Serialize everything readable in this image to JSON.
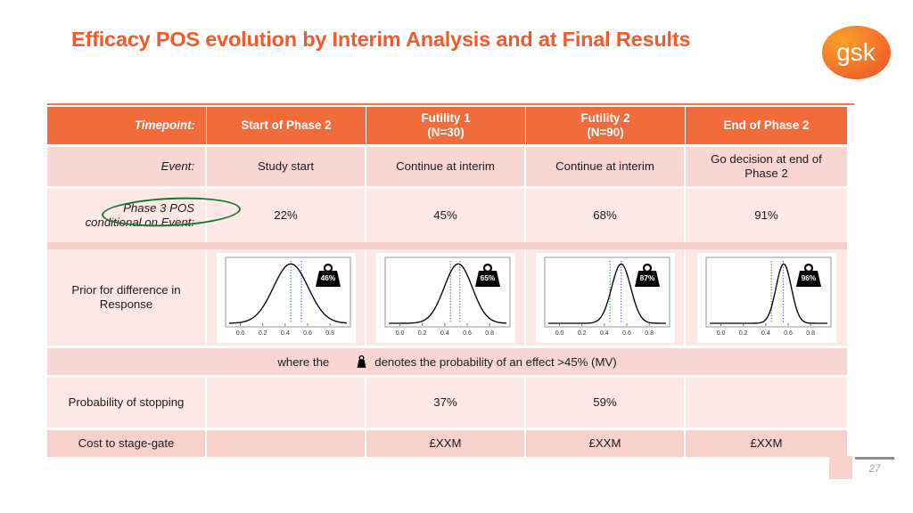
{
  "slide": {
    "title": "Efficacy POS evolution by Interim Analysis and at Final Results",
    "logo_text": "gsk",
    "page_number": "27",
    "accent_orange": "#F15A2B",
    "header_orange": "#F26B3A",
    "row_pink_dark": "#F9D6D1",
    "row_pink_light": "#FCE8E5",
    "annotation_green": "#11792E"
  },
  "table": {
    "header": {
      "label": "Timepoint:",
      "columns": [
        "Start of Phase 2",
        "Futility 1\n(N=30)",
        "Futility 2\n(N=90)",
        "End of Phase 2"
      ],
      "col1_line1": "Start of Phase 2",
      "col1_line2": "",
      "col2_line1": "Futility 1",
      "col2_line2": "(N=30)",
      "col3_line1": "Futility 2",
      "col3_line2": "(N=90)",
      "col4_line1": "End of Phase 2",
      "col4_line2": ""
    },
    "rows": [
      {
        "id": "event",
        "label": "Event:",
        "values": [
          "Study start",
          "Continue at interim",
          "Continue at interim",
          "Go decision at end of Phase 2"
        ],
        "v0": "Study start",
        "v1": "Continue at interim",
        "v2": "Continue at interim",
        "v3_line1": "Go decision at end of",
        "v3_line2": "Phase 2"
      },
      {
        "id": "phase3-pos",
        "label_line1": "Phase 3 POS",
        "label_line2": "conditional on Event:",
        "values": [
          "22%",
          "45%",
          "68%",
          "91%"
        ],
        "v0": "22%",
        "v1": "45%",
        "v2": "68%",
        "v3": "91%"
      },
      {
        "id": "prior-difference",
        "label_line1": "Prior for difference in",
        "label_line2": "Response"
      },
      {
        "id": "probability-of-stopping",
        "label": "Probability of stopping",
        "values": [
          "",
          "37%",
          "59%",
          ""
        ],
        "v0": "",
        "v1": "37%",
        "v2": "59%",
        "v3": ""
      },
      {
        "id": "cost-to-stage-gate",
        "label": "Cost to stage-gate",
        "values": [
          "",
          "£XXM",
          "£XXM",
          "£XXM"
        ],
        "v0": "",
        "v1": "£XXM",
        "v2": "£XXM",
        "v3": "£XXM"
      }
    ],
    "note": {
      "prefix": "where the",
      "suffix": "denotes the probability of an effect >45% (MV)",
      "icon": "weight-icon"
    }
  },
  "chart_data": [
    {
      "type": "line",
      "id": "prior-start-of-phase-2",
      "title": "",
      "xlabel": "",
      "ylabel": "",
      "xlim": [
        -0.1,
        0.95
      ],
      "ylim": [
        0,
        1.05
      ],
      "ticks": [
        "0.0",
        "0.2",
        "0.4",
        "0.6",
        "0.8"
      ],
      "tick_values": [
        0.0,
        0.2,
        0.4,
        0.6,
        0.8
      ],
      "grid": false,
      "curve": {
        "mean": 0.45,
        "sd": 0.155,
        "peak": 1.0
      },
      "vlines": [
        {
          "x": 0.45,
          "color": "#2E7D32",
          "style": "dotted",
          "name": "mean"
        },
        {
          "x": 0.545,
          "color": "#4C4CC8",
          "style": "dotted",
          "name": "threshold"
        }
      ],
      "badge": "46%",
      "badge_icon": "weight-icon"
    },
    {
      "type": "line",
      "id": "prior-futility-1",
      "title": "",
      "xlabel": "",
      "ylabel": "",
      "xlim": [
        -0.1,
        0.95
      ],
      "ylim": [
        0,
        1.05
      ],
      "ticks": [
        "0.0",
        "0.2",
        "0.4",
        "0.6",
        "0.8"
      ],
      "tick_values": [
        0.0,
        0.2,
        0.4,
        0.6,
        0.8
      ],
      "grid": false,
      "curve": {
        "mean": 0.52,
        "sd": 0.125,
        "peak": 1.0
      },
      "vlines": [
        {
          "x": 0.45,
          "color": "#2E7D32",
          "style": "dotted",
          "name": "mean"
        },
        {
          "x": 0.535,
          "color": "#4C4CC8",
          "style": "dotted",
          "name": "threshold"
        }
      ],
      "badge": "65%",
      "badge_icon": "weight-icon"
    },
    {
      "type": "line",
      "id": "prior-futility-2",
      "title": "",
      "xlabel": "",
      "ylabel": "",
      "xlim": [
        -0.1,
        0.95
      ],
      "ylim": [
        0,
        1.05
      ],
      "ticks": [
        "0.0",
        "0.2",
        "0.4",
        "0.6",
        "0.8"
      ],
      "tick_values": [
        0.0,
        0.2,
        0.4,
        0.6,
        0.8
      ],
      "grid": false,
      "curve": {
        "mean": 0.55,
        "sd": 0.085,
        "peak": 1.0
      },
      "vlines": [
        {
          "x": 0.45,
          "color": "#2E7D32",
          "style": "dotted",
          "name": "mean"
        },
        {
          "x": 0.55,
          "color": "#4C4CC8",
          "style": "dotted",
          "name": "threshold"
        }
      ],
      "badge": "87%",
      "badge_icon": "weight-icon"
    },
    {
      "type": "line",
      "id": "prior-end-of-phase-2",
      "title": "",
      "xlabel": "",
      "ylabel": "",
      "xlim": [
        -0.1,
        0.95
      ],
      "ylim": [
        0,
        1.05
      ],
      "ticks": [
        "0.0",
        "0.2",
        "0.4",
        "0.6",
        "0.8"
      ],
      "tick_values": [
        0.0,
        0.2,
        0.4,
        0.6,
        0.8
      ],
      "grid": false,
      "curve": {
        "mean": 0.56,
        "sd": 0.068,
        "peak": 1.0
      },
      "vlines": [
        {
          "x": 0.45,
          "color": "#2E7D32",
          "style": "dotted",
          "name": "mean"
        },
        {
          "x": 0.555,
          "color": "#4C4CC8",
          "style": "dotted",
          "name": "threshold"
        }
      ],
      "badge": "96%",
      "badge_icon": "weight-icon"
    }
  ]
}
